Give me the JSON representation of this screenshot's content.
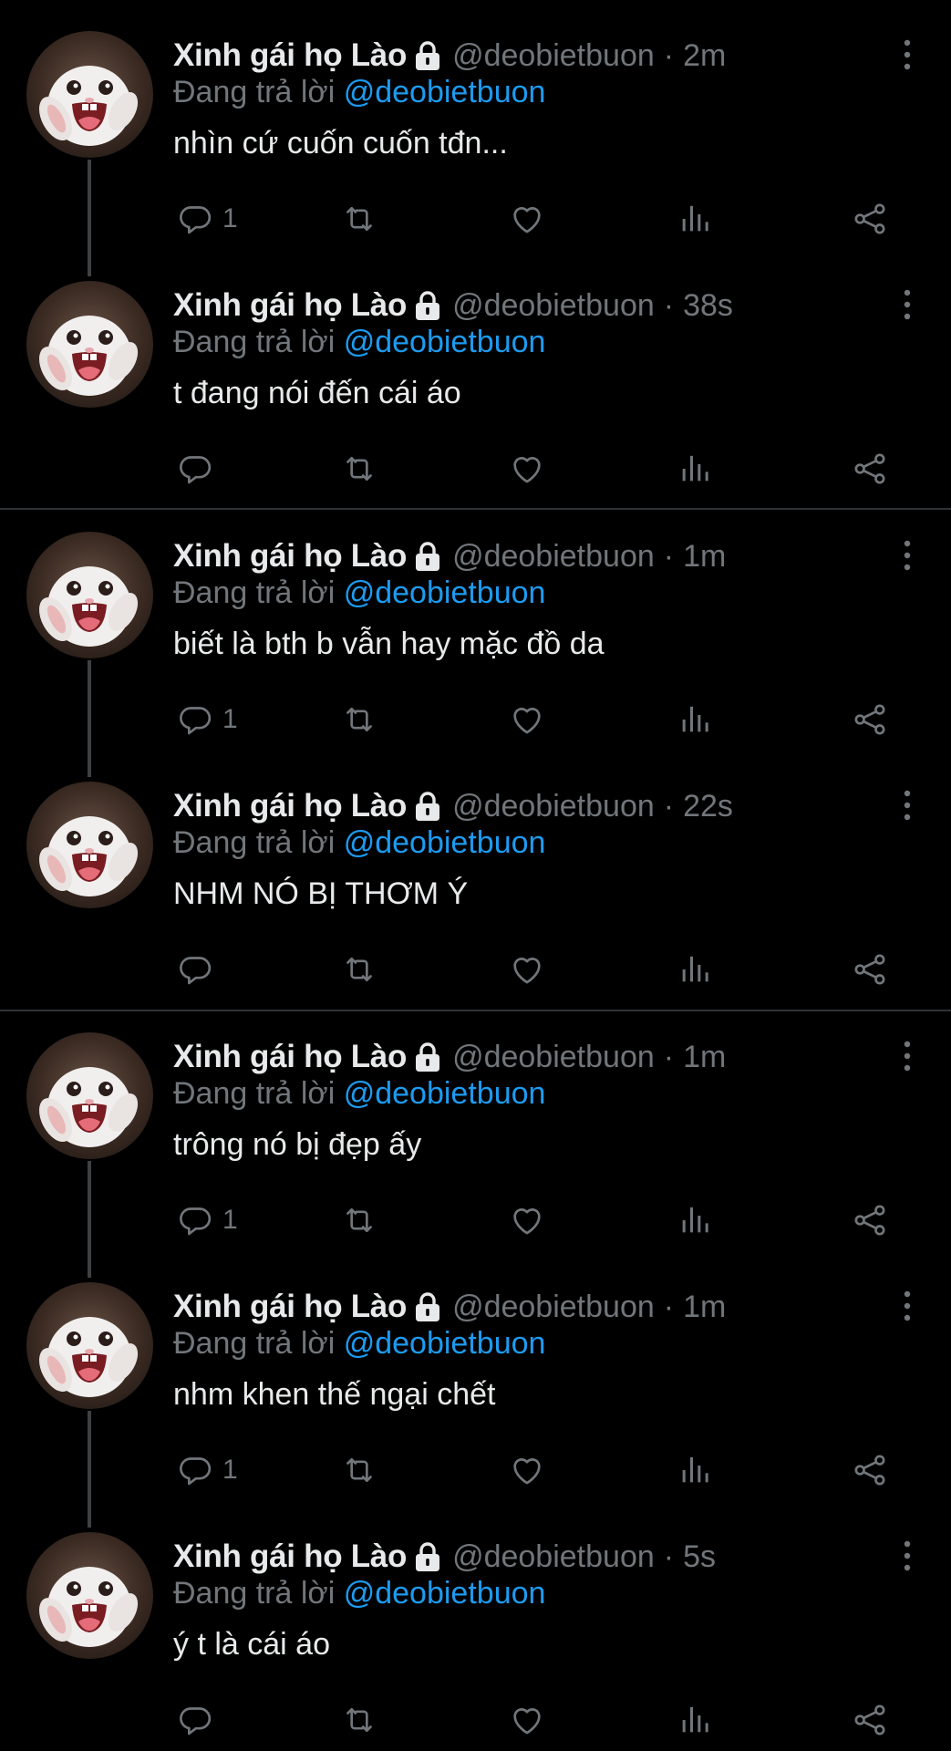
{
  "icons": {
    "reply": "reply-icon",
    "retweet": "retweet-icon",
    "like": "heart-icon",
    "views": "views-icon",
    "share": "share-icon",
    "more": "more-vertical-icon",
    "lock": "lock-icon"
  },
  "colors": {
    "background": "#000000",
    "text": "#e7e9ea",
    "muted": "#71767b",
    "accent": "#1d9bf0"
  },
  "tweets": [
    {
      "display_name": "Xinh gái họ Lào",
      "handle": "@deobietbuon",
      "dot": "·",
      "time": "2m",
      "reply_prefix": "Đang trả lời",
      "reply_to": "@deobietbuon",
      "text": "nhìn cứ cuốn cuốn tđn...",
      "reply_count": "1"
    },
    {
      "display_name": "Xinh gái họ Lào",
      "handle": "@deobietbuon",
      "dot": "·",
      "time": "38s",
      "reply_prefix": "Đang trả lời",
      "reply_to": "@deobietbuon",
      "text": "t đang nói đến cái áo",
      "reply_count": ""
    },
    {
      "display_name": "Xinh gái họ Lào",
      "handle": "@deobietbuon",
      "dot": "·",
      "time": "1m",
      "reply_prefix": "Đang trả lời",
      "reply_to": "@deobietbuon",
      "text": "biết là bth b vẫn hay mặc đồ da",
      "reply_count": "1"
    },
    {
      "display_name": "Xinh gái họ Lào",
      "handle": "@deobietbuon",
      "dot": "·",
      "time": "22s",
      "reply_prefix": "Đang trả lời",
      "reply_to": "@deobietbuon",
      "text": "NHM NÓ BỊ THƠM Ý",
      "reply_count": ""
    },
    {
      "display_name": "Xinh gái họ Lào",
      "handle": "@deobietbuon",
      "dot": "·",
      "time": "1m",
      "reply_prefix": "Đang trả lời",
      "reply_to": "@deobietbuon",
      "text": "trông nó bị đẹp ấy",
      "reply_count": "1"
    },
    {
      "display_name": "Xinh gái họ Lào",
      "handle": "@deobietbuon",
      "dot": "·",
      "time": "1m",
      "reply_prefix": "Đang trả lời",
      "reply_to": "@deobietbuon",
      "text": "nhm khen thế ngại chết",
      "reply_count": "1"
    },
    {
      "display_name": "Xinh gái họ Lào",
      "handle": "@deobietbuon",
      "dot": "·",
      "time": "5s",
      "reply_prefix": "Đang trả lời",
      "reply_to": "@deobietbuon",
      "text": "ý t là cái áo",
      "reply_count": ""
    }
  ]
}
